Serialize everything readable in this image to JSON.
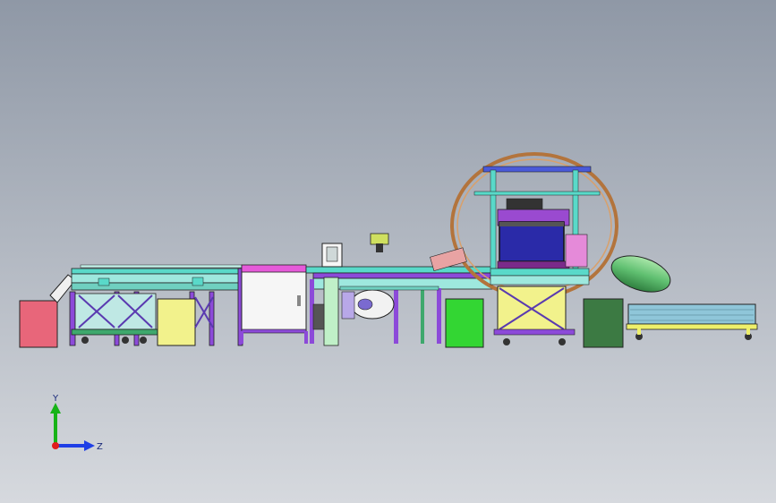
{
  "viewport": {
    "background_top": "#8f98a6",
    "background_bottom": "#d6d9de"
  },
  "triad": {
    "y_label": "Y",
    "z_label": "Z",
    "y_color": "#17b317",
    "z_color": "#1f3fe6",
    "origin_color": "#e01c1c"
  },
  "colors": {
    "frame_teal": "#59d9c9",
    "frame_purple": "#8c4ad9",
    "frame_green": "#3ea86d",
    "bin_pink": "#e8667a",
    "bin_yellow": "#f2f28c",
    "bin_green": "#33d633",
    "bin_darkgreen": "#3c7a43",
    "ring_brown": "#b3743c",
    "monitor_blue": "#2a2aa8",
    "hood_green": "#5fbf70",
    "outfeed_blue": "#8fc6d9",
    "outfeed_yellow": "#eef06a",
    "cabinet_white": "#f6f6f6"
  }
}
